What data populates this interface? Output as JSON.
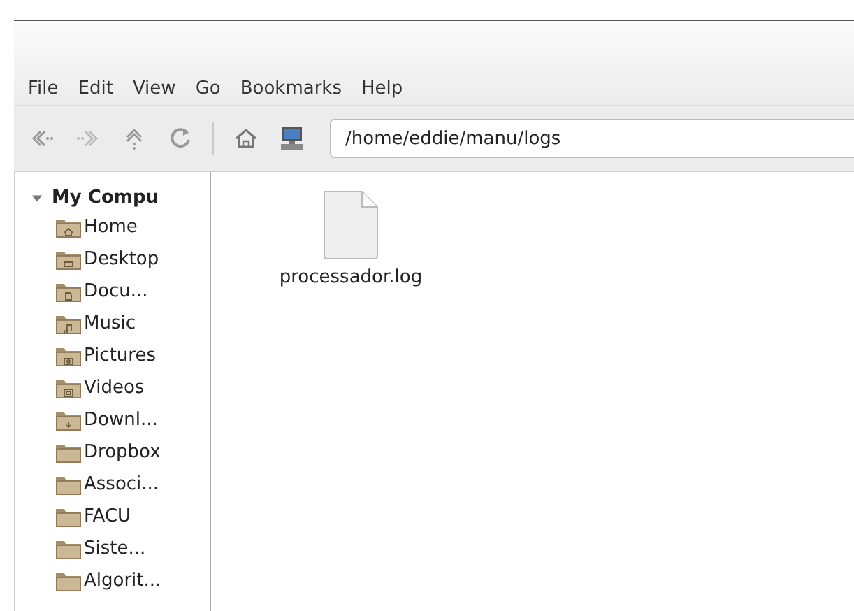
{
  "menu": [
    "File",
    "Edit",
    "View",
    "Go",
    "Bookmarks",
    "Help"
  ],
  "toolbar": {
    "location": "/home/eddie/manu/logs"
  },
  "sidebar": {
    "title": "My Compu",
    "expanded": true,
    "items": [
      {
        "label": "Home",
        "kind": "home"
      },
      {
        "label": "Desktop",
        "kind": "desktop"
      },
      {
        "label": "Docu...",
        "kind": "documents"
      },
      {
        "label": "Music",
        "kind": "music"
      },
      {
        "label": "Pictures",
        "kind": "pictures"
      },
      {
        "label": "Videos",
        "kind": "videos"
      },
      {
        "label": "Downl...",
        "kind": "downloads"
      },
      {
        "label": "Dropbox",
        "kind": "plain"
      },
      {
        "label": "Associ...",
        "kind": "plain"
      },
      {
        "label": "FACU",
        "kind": "plain"
      },
      {
        "label": "Siste...",
        "kind": "plain"
      },
      {
        "label": "Algorit...",
        "kind": "plain"
      }
    ]
  },
  "files": [
    {
      "name": "processador.log"
    }
  ]
}
